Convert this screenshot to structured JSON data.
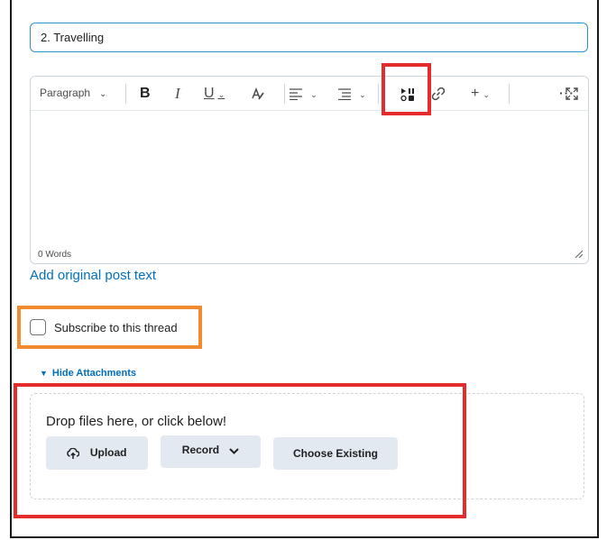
{
  "subject": {
    "value": "2. Travelling"
  },
  "toolbar": {
    "paragraph_label": "Paragraph",
    "dropdown_chevron": "⌄",
    "bold": "B",
    "italic": "I",
    "underline": "U",
    "format_glyph": "A⁄",
    "align_glyph": "≡",
    "list_glyph": "☰",
    "media_glyph": "▶⫴",
    "link_glyph": "🔗",
    "plus_glyph": "+",
    "more_glyph": "···",
    "fullscreen_glyph": "⤢"
  },
  "editor": {
    "word_count": "0 Words"
  },
  "add_original_post_text": "Add original post text",
  "subscribe": {
    "label": "Subscribe to this thread",
    "checked": false
  },
  "attachments": {
    "toggle_label": "Hide Attachments",
    "drop_text": "Drop files here, or click below!",
    "upload_label": "Upload",
    "record_label": "Record",
    "choose_label": "Choose Existing"
  },
  "colors": {
    "accent": "#006fbf",
    "subject_border": "#2e93c8",
    "highlight_red": "#e52b2b",
    "highlight_orange": "#f28a2e",
    "button_bg": "#e3e9f1"
  }
}
